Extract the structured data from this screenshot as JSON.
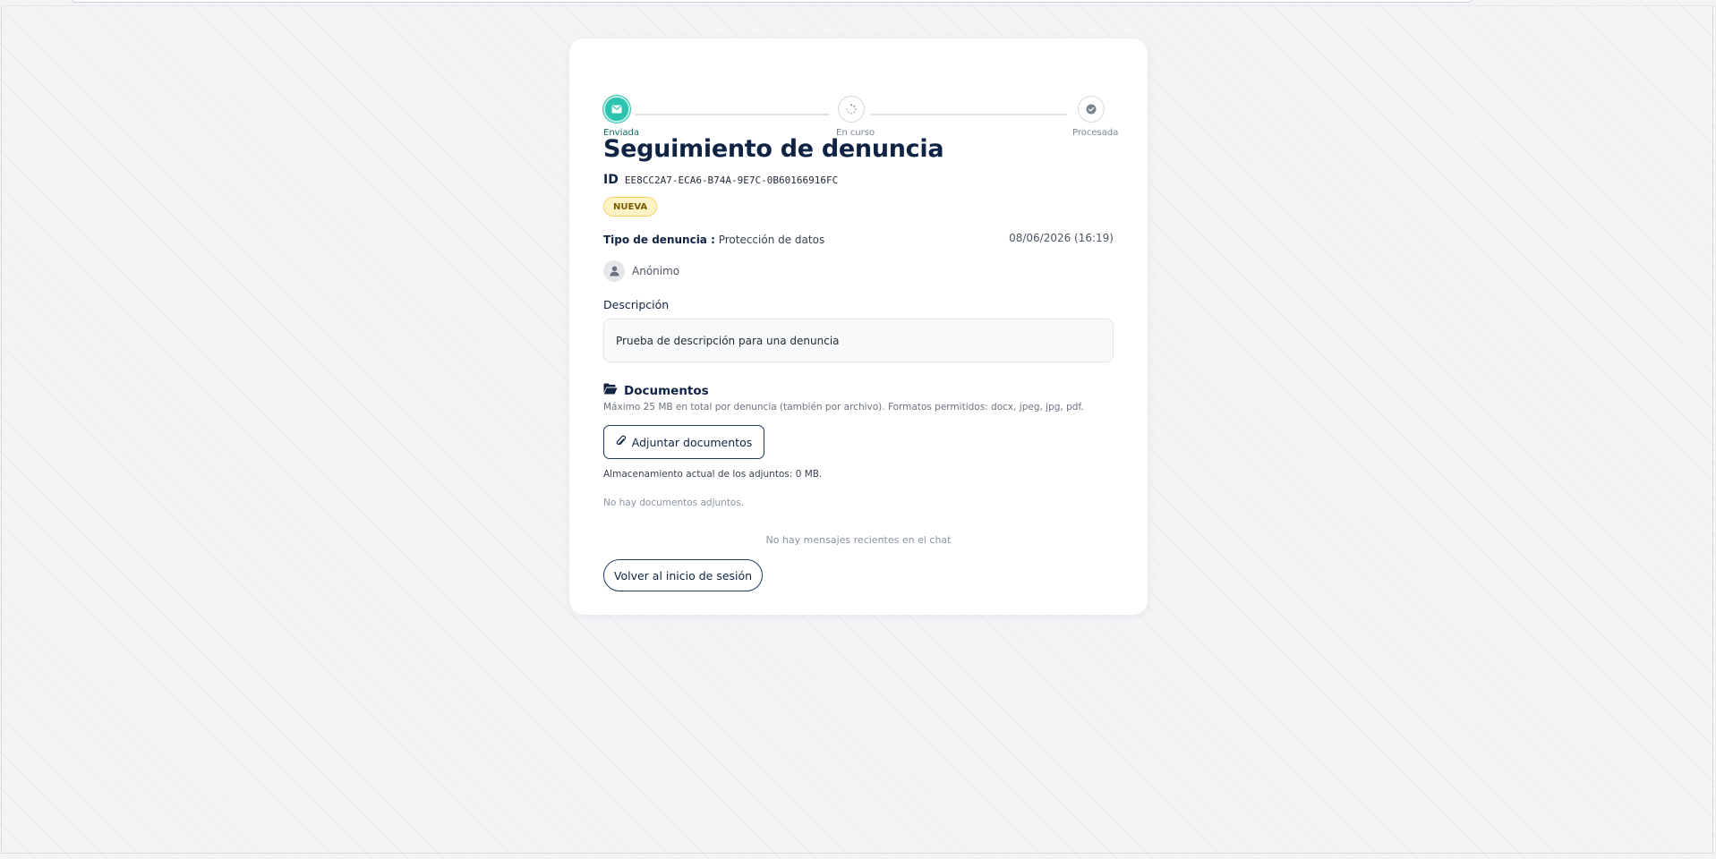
{
  "stepper": {
    "steps": [
      {
        "label": "Enviada",
        "icon": "envelope-icon",
        "state": "done"
      },
      {
        "label": "En curso",
        "icon": "spinner-icon",
        "state": "pending"
      },
      {
        "label": "Procesada",
        "icon": "check-circle-icon",
        "state": "pending"
      }
    ]
  },
  "complaint": {
    "title": "Seguimiento de denuncia",
    "id_label": "ID",
    "id_value": "EE8CC2A7-ECA6-B74A-9E7C-0B60166916FC",
    "status_badge": "NUEVA",
    "type_label": "Tipo de denuncia :",
    "type_value": "Protección de datos",
    "date": "08/06/2026 (16:19)",
    "reporter": "Anónimo",
    "description_label": "Descripción",
    "description_text": "Prueba de descripción para una denuncia"
  },
  "documents": {
    "title": "Documentos",
    "help": "Máximo 25 MB en total por denuncia (también por archivo). Formatos permitidos: docx, jpeg, jpg, pdf.",
    "attach_label": "Adjuntar documentos",
    "storage_text": "Almacenamiento actual de los adjuntos: 0 MB.",
    "empty_text": "No hay documentos adjuntos."
  },
  "chat": {
    "empty_text": "No hay mensajes recientes en el chat"
  },
  "actions": {
    "back_label": "Volver al inicio de sesión"
  },
  "colors": {
    "primary": "#0f2444",
    "accent_teal": "#2bc3ad",
    "badge_bg": "#fef3c7",
    "badge_border": "#f6d35a"
  }
}
